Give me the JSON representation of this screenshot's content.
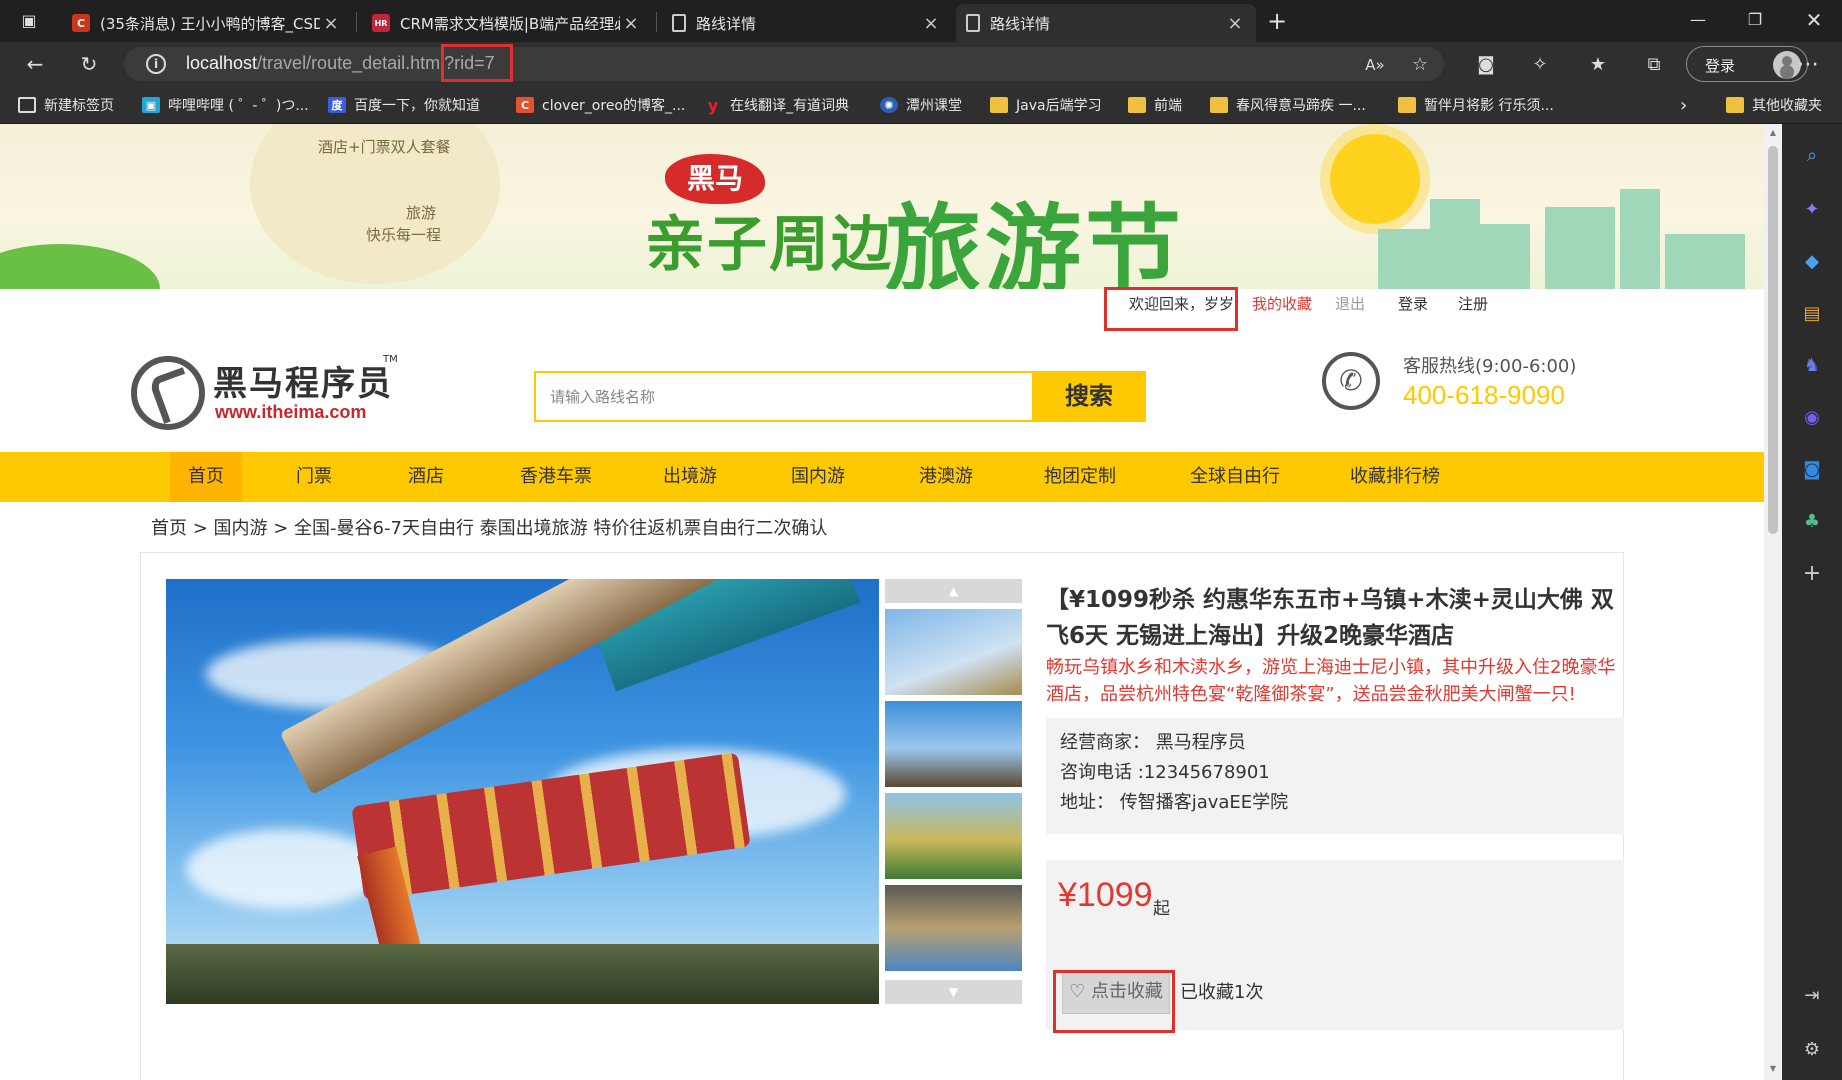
{
  "browser": {
    "tabs": [
      {
        "title": "(35条消息) 王小小鸭的博客_CSDN",
        "favicon": "C",
        "color": "#c8361c"
      },
      {
        "title": "CRM需求文档模版|B端产品经理必",
        "favicon": "HR",
        "color": "#c0263a"
      },
      {
        "title": "路线详情",
        "favicon": "",
        "color": ""
      },
      {
        "title": "路线详情",
        "favicon": "",
        "color": ""
      }
    ],
    "url_host": "localhost",
    "url_path": "/travel/route_detail.html?rid=7",
    "profile_button": "登录",
    "bookmarks": [
      {
        "label": "新建标签页",
        "icon": "new-tab-icon"
      },
      {
        "label": "哔哩哔哩 ( ゜- ゜)つ...",
        "icon": "bilibili-icon"
      },
      {
        "label": "百度一下，你就知道",
        "icon": "baidu-icon"
      },
      {
        "label": "clover_oreo的博客_...",
        "icon": "csdn-icon"
      },
      {
        "label": "在线翻译_有道词典",
        "icon": "youdao-icon"
      },
      {
        "label": "潭州课堂",
        "icon": "tanzhou-icon"
      },
      {
        "label": "Java后端学习",
        "icon": "folder-icon"
      },
      {
        "label": "前端",
        "icon": "folder-icon"
      },
      {
        "label": "春风得意马蹄疾 一...",
        "icon": "folder-icon"
      },
      {
        "label": "暂伴月将影 行乐须...",
        "icon": "folder-icon"
      }
    ],
    "other_bookmarks": "其他收藏夹"
  },
  "banner": {
    "cloud_line1": "酒店+门票双人套餐",
    "cloud_line2": "旅游",
    "cloud_line3": "快乐每一程",
    "badge": "黑马",
    "title_small": "亲子周边",
    "title_big": "旅游节"
  },
  "header": {
    "welcome": "欢迎回来，岁岁",
    "my_favorites": "我的收藏",
    "logout": "退出",
    "login": "登录",
    "register": "注册",
    "logo_name": "黑马程序员",
    "logo_tm": "TM",
    "logo_url": "www.itheima.com",
    "search_placeholder": "请输入路线名称",
    "search_button": "搜索",
    "hotline_label": "客服热线(9:00-6:00)",
    "hotline_number": "400-618-9090"
  },
  "nav": [
    "首页",
    "门票",
    "酒店",
    "香港车票",
    "出境游",
    "国内游",
    "港澳游",
    "抱团定制",
    "全球自由行",
    "收藏排行榜"
  ],
  "breadcrumb": "首页 > 国内游 > 全国-曼谷6-7天自由行 泰国出境旅游 特价往返机票自由行二次确认",
  "route": {
    "title": "【¥1099秒杀 约惠华东五市+乌镇+木渎+灵山大佛 双飞6天 无锡进上海出】升级2晚豪华酒店",
    "subtitle": "畅玩乌镇水乡和木渎水乡，游览上海迪士尼小镇，其中升级入住2晚豪华酒店，品尝杭州特色宴“乾隆御茶宴”，送品尝金秋肥美大闸蟹一只!",
    "seller": "经营商家： 黑马程序员",
    "phone": "咨询电话 :12345678901",
    "address": "地址： 传智播客javaEE学院",
    "price": "¥1099",
    "price_unit": "起",
    "favorite_button": "点击收藏",
    "favorite_count": "已收藏1次"
  },
  "colors": {
    "accent": "#ffc900",
    "price_red": "#e3372f",
    "highlight_red": "#e0302e"
  }
}
